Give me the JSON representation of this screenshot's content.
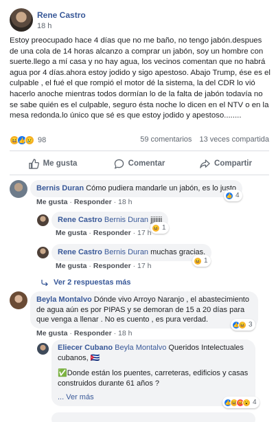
{
  "post": {
    "author": "Rene Castro",
    "time": "18 h",
    "text": "Estoy preocupado hace 4 días que no me baño, no tengo jabón.despues de una cola de 14 horas alcanzo a comprar un jabón, soy un hombre con suerte.llego a mí casa y no hay agua, los vecinos comentan que no habrá agua por 4 días.ahora estoy jodido y sigo apestoso. Abajo Trump, ése es el culpable , el fué el que rompió el motor dé la sistema, la del CDR lo vió hacerlo anoche mientras todos dormían lo de la falta de jabón todavía no se sabe quién es el culpable, seguro ésta noche lo dicen en el NTV o en la mesa redonda.lo único que sé es que estoy jodido y apestoso........",
    "reactions_count": "98",
    "comments_count": "59 comentarios",
    "shares_count": "13 veces compartida",
    "actions": {
      "like": "Me gusta",
      "comment": "Comentar",
      "share": "Compartir"
    }
  },
  "comments": [
    {
      "author": "Bernis Duran",
      "text": "Cómo pudiera mandarle un jabón, es lo justo",
      "like_label": "Me gusta",
      "reply_label": "Responder",
      "time": "18 h",
      "reactions": "4"
    },
    {
      "author": "Rene Castro",
      "tag": "Bernis Duran",
      "text": "jjjjjjj",
      "like_label": "Me gusta",
      "reply_label": "Responder",
      "time": "17 h",
      "reactions": "1"
    },
    {
      "author": "Rene Castro",
      "tag": "Bernis Duran",
      "text": "muchas gracias.",
      "like_label": "Me gusta",
      "reply_label": "Responder",
      "time": "17 h",
      "reactions": "1"
    },
    {
      "author": "Beyla Montalvo",
      "text": "Dónde vivo Arroyo Naranjo , el abastecimiento de agua aún es por PIPAS y se demoran de 15 a 20 días para que venga a llenar . No es cuento , es pura verdad.",
      "like_label": "Me gusta",
      "reply_label": "Responder",
      "time": "18 h",
      "reactions": "3"
    },
    {
      "author": "Eliecer Cubano",
      "tag": "Beyla Montalvo",
      "text": "Queridos Intelectuales cubanos,",
      "flag": "🇨🇺",
      "check": "✅",
      "text2": "Donde están los puentes, carreteras, edificios y casas construidos durante 61 años ?",
      "see_more": "... Ver más",
      "reactions": "4"
    }
  ],
  "more_replies": "Ver 2 respuestas más"
}
